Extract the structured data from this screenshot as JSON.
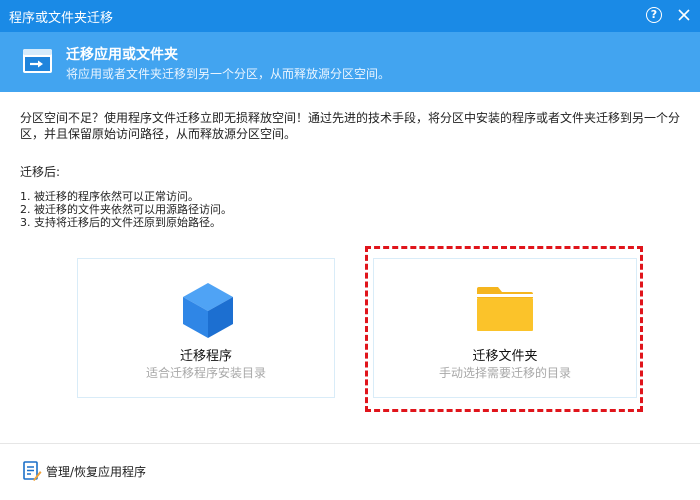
{
  "window": {
    "title": "程序或文件夹迁移",
    "help_label": "?",
    "accent_color": "#1a8ae6"
  },
  "header": {
    "icon": "app-move-icon",
    "title": "迁移应用或文件夹",
    "subtitle": "将应用或者文件夹迁移到另一个分区，从而释放源分区空间。"
  },
  "intro": {
    "text": "分区空间不足？使用程序文件迁移立即无损释放空间！通过先进的技术手段，将分区中安装的程序或者文件夹迁移到另一个分区，并且保留原始访问路径，从而释放源分区空间。"
  },
  "after": {
    "label": "迁移后:",
    "items": [
      "1. 被迁移的程序依然可以正常访问。",
      "2. 被迁移的文件夹依然可以用源路径访问。",
      "3. 支持将迁移后的文件还原到原始路径。"
    ]
  },
  "cards": [
    {
      "icon": "cube-icon",
      "title": "迁移程序",
      "subtitle": "适合迁移程序安装目录"
    },
    {
      "icon": "folder-icon",
      "title": "迁移文件夹",
      "subtitle": "手动选择需要迁移的目录",
      "highlighted": true,
      "highlight_color": "#e0141b"
    }
  ],
  "footer": {
    "icon": "manage-list-icon",
    "link_label": "管理/恢复应用程序"
  }
}
